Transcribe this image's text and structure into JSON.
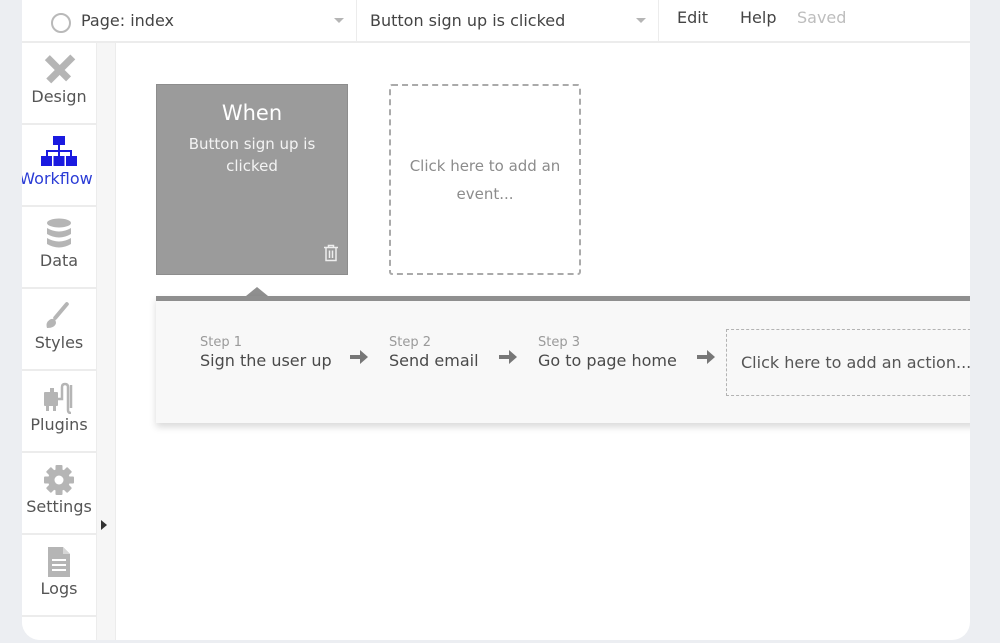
{
  "topbar": {
    "page_select": "Page: index",
    "event_select": "Button sign up is clicked",
    "menu": [
      {
        "label": "Edit"
      },
      {
        "label": "Help"
      }
    ],
    "status": "Saved"
  },
  "sidebar": {
    "items": [
      {
        "label": "Design",
        "icon": "design-tools-icon",
        "active": false
      },
      {
        "label": "Workflow",
        "icon": "workflow-sitemap-icon",
        "active": true
      },
      {
        "label": "Data",
        "icon": "database-icon",
        "active": false
      },
      {
        "label": "Styles",
        "icon": "paintbrush-icon",
        "active": false
      },
      {
        "label": "Plugins",
        "icon": "plug-icon",
        "active": false
      },
      {
        "label": "Settings",
        "icon": "gear-icon",
        "active": false
      },
      {
        "label": "Logs",
        "icon": "document-icon",
        "active": false
      }
    ]
  },
  "colors": {
    "accent": "#2b3cd6",
    "event_card": "#9b9b9b",
    "panel_bar": "#8f8f8f"
  },
  "event": {
    "title": "When",
    "subtitle": "Button sign up is clicked"
  },
  "add_event_label": "Click here to add an event...",
  "steps": [
    {
      "num": "Step 1",
      "name": "Sign the user up"
    },
    {
      "num": "Step 2",
      "name": "Send email"
    },
    {
      "num": "Step 3",
      "name": "Go to page home"
    }
  ],
  "add_action_label": "Click here to add an action..."
}
